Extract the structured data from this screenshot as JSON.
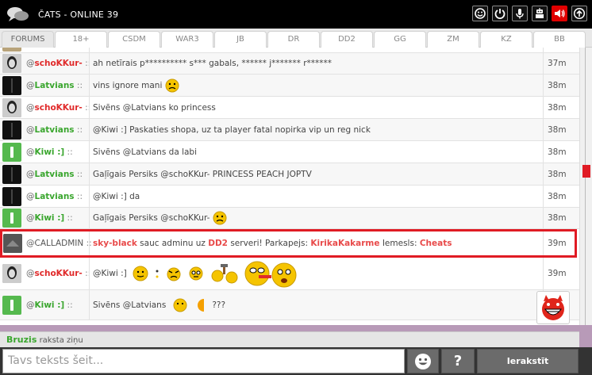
{
  "header": {
    "title": "ČATS - ONLINE 39",
    "icons": [
      "smiley-icon",
      "power-icon",
      "microphone-icon",
      "robot-icon",
      "volume-icon",
      "upload-icon"
    ],
    "accent": "#e00000"
  },
  "tabs": [
    {
      "label": "FORUMS",
      "active": true
    },
    {
      "label": "18+"
    },
    {
      "label": "CSDM"
    },
    {
      "label": "WAR3"
    },
    {
      "label": "JB"
    },
    {
      "label": "DR"
    },
    {
      "label": "DD2"
    },
    {
      "label": "GG"
    },
    {
      "label": "ZM"
    },
    {
      "label": "KZ"
    },
    {
      "label": "BB"
    }
  ],
  "messages": [
    {
      "user": "schoKKur-",
      "color": "red",
      "text": "ah netīrais p********** s*** gabals, ****** j******* r******",
      "time": "37m"
    },
    {
      "user": "Latvians",
      "color": "green",
      "text": "vins ignore mani",
      "time": "38m"
    },
    {
      "user": "schoKKur-",
      "color": "red",
      "text": "Sivēns @Latvians ko princess",
      "time": "38m"
    },
    {
      "user": "Latvians",
      "color": "green",
      "text": "@Kiwi :] Paskaties shopa, uz ta player fatal nopirka vip un reg nick",
      "time": "38m"
    },
    {
      "user": "Kiwi :]",
      "color": "green",
      "text": "Sivēns @Latvians da labi",
      "time": "38m"
    },
    {
      "user": "Latvians",
      "color": "green",
      "text": "Gaļīgais Persiks @schoKKur- PRINCESS PEACH JOPTV",
      "time": "38m"
    },
    {
      "user": "Latvians",
      "color": "green",
      "text": "@Kiwi :] da",
      "time": "38m"
    },
    {
      "user": "Kiwi :]",
      "color": "green",
      "text": "Gaļīgais Persiks @schoKKur-",
      "time": "38m"
    }
  ],
  "admin": {
    "user": "CALLADMIN",
    "reporter": "sky-black",
    "t1": " sauc adminu uz ",
    "server": "DD2",
    "t2": " serveri! Parkapejs: ",
    "offender": "KirikaKakarme",
    "t3": " Iemesls: ",
    "reason": "Cheats",
    "time": "39m"
  },
  "after": [
    {
      "user": "schoKKur-",
      "color": "red",
      "text": "@Kiwi :]",
      "time": "39m"
    },
    {
      "user": "Kiwi :]",
      "color": "green",
      "text": "Sivēns @Latvians",
      "suffix": "???",
      "time": ""
    }
  ],
  "typing": {
    "who": "Bruzis",
    "label": "raksta ziņu"
  },
  "input": {
    "placeholder": "Tavs teksts šeit...",
    "help": "?",
    "send": "Ierakstīt"
  },
  "user_sep": "::",
  "at": "@"
}
